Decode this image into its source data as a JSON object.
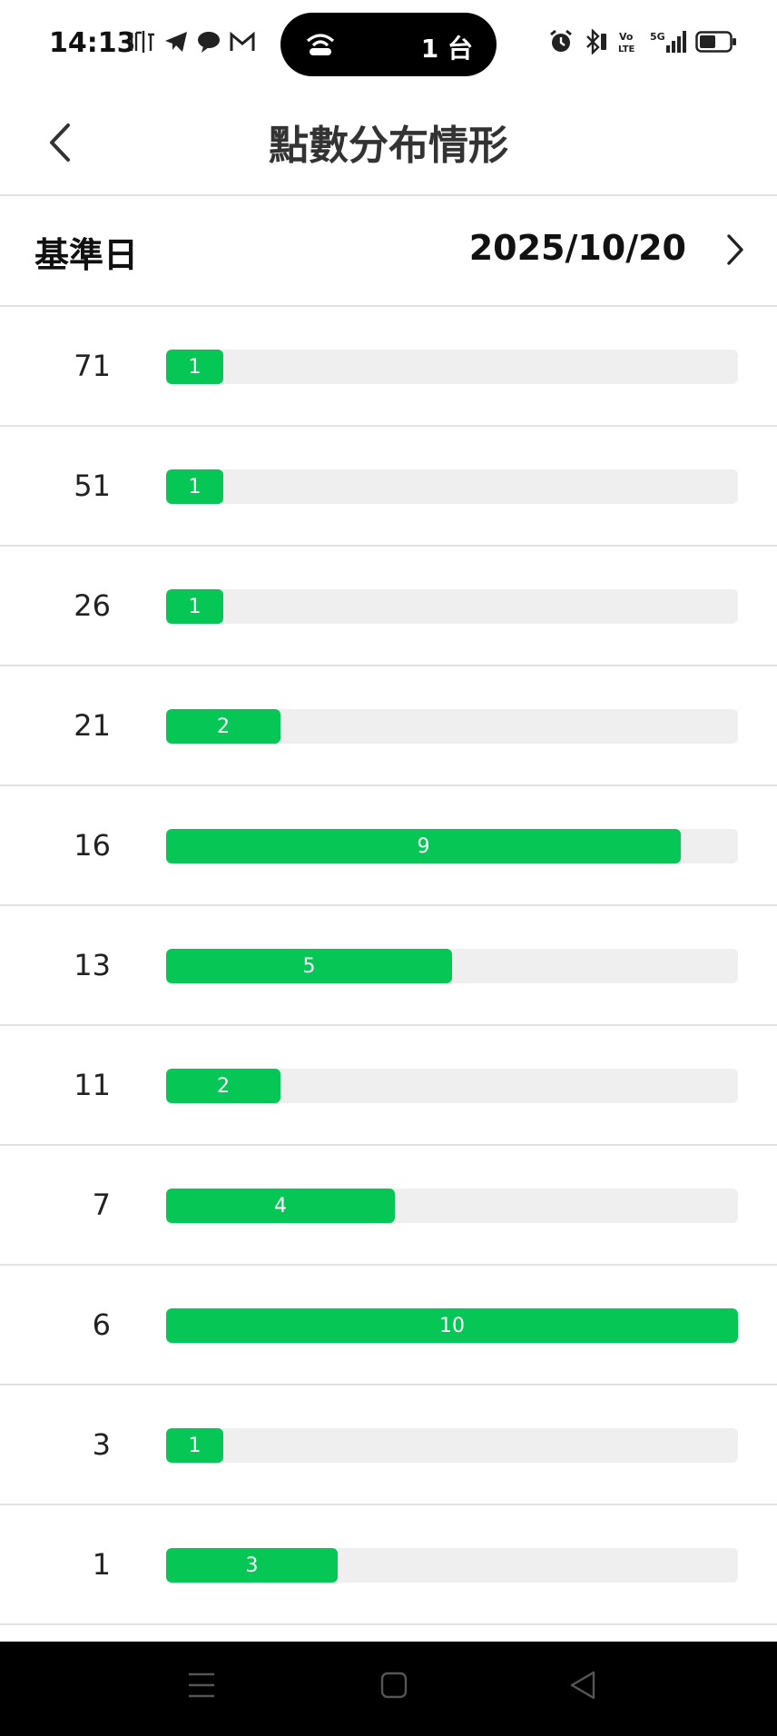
{
  "status_bar": {
    "time": "14:13",
    "pill_text": "1 台"
  },
  "header": {
    "title": "點數分布情形"
  },
  "base_date": {
    "label": "基準日",
    "value": "2025/10/20"
  },
  "distribution": {
    "max_count": 10,
    "rows": [
      {
        "points": "71",
        "count": 1
      },
      {
        "points": "51",
        "count": 1
      },
      {
        "points": "26",
        "count": 1
      },
      {
        "points": "21",
        "count": 2
      },
      {
        "points": "16",
        "count": 9
      },
      {
        "points": "13",
        "count": 5
      },
      {
        "points": "11",
        "count": 2
      },
      {
        "points": "7",
        "count": 4
      },
      {
        "points": "6",
        "count": 10
      },
      {
        "points": "3",
        "count": 1
      },
      {
        "points": "1",
        "count": 3
      }
    ]
  },
  "colors": {
    "bar_fill": "#06c755",
    "bar_track": "#efefef"
  },
  "icons": {
    "back": "chevron-left-icon",
    "next": "chevron-right-icon",
    "nav_menu": "menu-icon",
    "nav_home": "square-icon",
    "nav_back": "triangle-left-icon"
  }
}
